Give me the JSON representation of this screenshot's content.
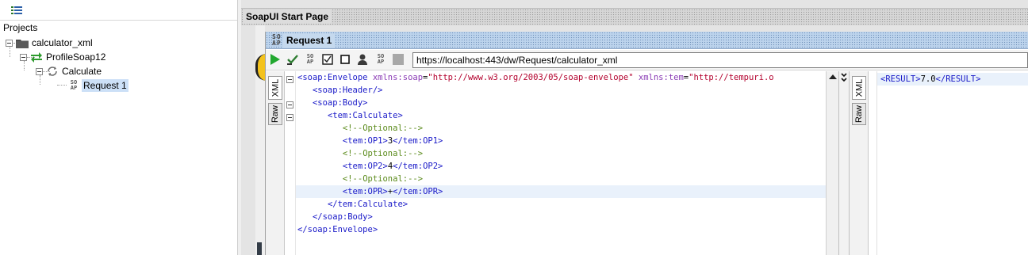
{
  "navigator": {
    "toolbar_icon": "project-list-icon",
    "heading": "Projects",
    "tree": {
      "project": {
        "label": "calculator_xml",
        "icon": "folder-icon"
      },
      "interface": {
        "label": "ProfileSoap12",
        "icon": "soap-interface-icon"
      },
      "operation": {
        "label": "Calculate",
        "icon": "operation-cycle-icon"
      },
      "request": {
        "label": "Request 1",
        "icon": "soap-request-icon",
        "selected": true
      }
    }
  },
  "desktop": {
    "start_tab_label": "SoapUI Start Page"
  },
  "request_window": {
    "title": "Request 1",
    "title_icon_text": "SO AP",
    "toolbar": {
      "buttons": [
        "run-icon",
        "validate-icon",
        "soap-add-icon",
        "checkbox-icon",
        "stop-icon",
        "user-icon",
        "soap-create-icon",
        "gray-square-icon"
      ],
      "endpoint": "https://localhost:443/dw/Request/calculator_xml"
    },
    "request_tabs": {
      "xml": "XML",
      "raw": "Raw"
    },
    "request_xml": [
      {
        "indent": 0,
        "parts": [
          [
            "tag",
            "<soap:Envelope "
          ],
          [
            "attr",
            "xmlns:soap"
          ],
          [
            "txt",
            "="
          ],
          [
            "str",
            "\"http://www.w3.org/2003/05/soap-envelope\""
          ],
          [
            "txt",
            " "
          ],
          [
            "attr",
            "xmlns:tem"
          ],
          [
            "txt",
            "="
          ],
          [
            "str",
            "\"http://tempuri.o"
          ]
        ]
      },
      {
        "indent": 1,
        "parts": [
          [
            "tag",
            "<soap:Header/>"
          ]
        ]
      },
      {
        "indent": 1,
        "parts": [
          [
            "tag",
            "<soap:Body>"
          ]
        ]
      },
      {
        "indent": 2,
        "parts": [
          [
            "tag",
            "<tem:Calculate>"
          ]
        ]
      },
      {
        "indent": 3,
        "parts": [
          [
            "cmt",
            "<!--Optional:-->"
          ]
        ]
      },
      {
        "indent": 3,
        "parts": [
          [
            "tag",
            "<tem:OP1>"
          ],
          [
            "txt",
            "3"
          ],
          [
            "tag",
            "</tem:OP1>"
          ]
        ]
      },
      {
        "indent": 3,
        "parts": [
          [
            "cmt",
            "<!--Optional:-->"
          ]
        ]
      },
      {
        "indent": 3,
        "parts": [
          [
            "tag",
            "<tem:OP2>"
          ],
          [
            "txt",
            "4"
          ],
          [
            "tag",
            "</tem:OP2>"
          ]
        ]
      },
      {
        "indent": 3,
        "parts": [
          [
            "cmt",
            "<!--Optional:-->"
          ]
        ]
      },
      {
        "indent": 3,
        "highlight": true,
        "parts": [
          [
            "tag",
            "<tem:OPR>"
          ],
          [
            "txt",
            "+"
          ],
          [
            "tag",
            "</tem:OPR>"
          ]
        ]
      },
      {
        "indent": 2,
        "parts": [
          [
            "tag",
            "</tem:Calculate>"
          ]
        ]
      },
      {
        "indent": 1,
        "parts": [
          [
            "tag",
            "</soap:Body>"
          ]
        ]
      },
      {
        "indent": 0,
        "parts": [
          [
            "tag",
            "</soap:Envelope>"
          ]
        ]
      }
    ],
    "response_tabs": {
      "xml": "XML",
      "raw": "Raw"
    },
    "response_xml": {
      "open_tag": "<RESULT>",
      "value": "7.0",
      "close_tag": "</RESULT>"
    }
  },
  "colors": {
    "xml_tag": "#1919c8",
    "xml_attr": "#8a3bb5",
    "xml_string": "#b3002d",
    "xml_comment": "#5a8a1a",
    "selection": "#cce0f7",
    "title_bar": "#bcd3ec"
  }
}
